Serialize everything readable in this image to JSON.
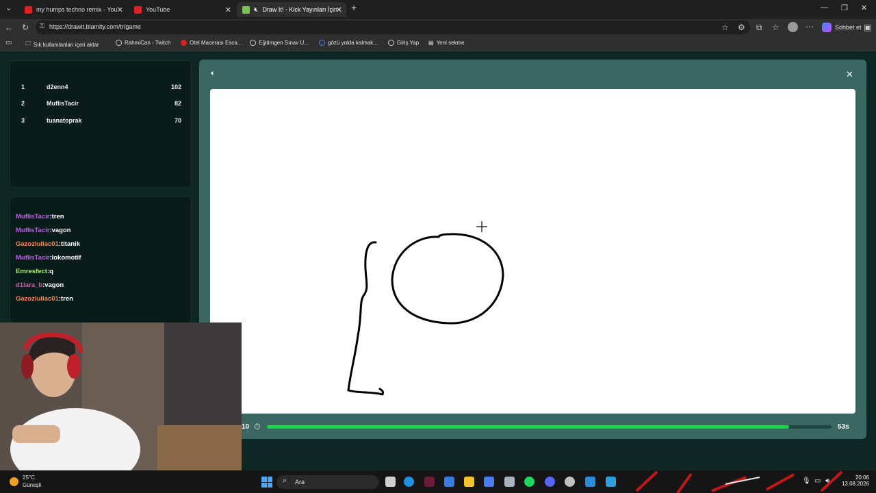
{
  "browser": {
    "tabs": [
      {
        "label": "my humps techno remix - YouTub",
        "active": false
      },
      {
        "label": "YouTube",
        "active": false
      },
      {
        "label": "Draw It! - Kick Yayınları İçin Ç",
        "active": true
      }
    ],
    "url": "https://drawit.blamity.com/tr/game",
    "profile_label": "Sohbet et",
    "bookmarks": [
      "Sık kullanılanları içeri aktar",
      "RahmiCan - Twitch",
      "Otel Macerası Esca...",
      "Eğitimgen Sınav U...",
      "gözü yolda kalmak...",
      "Giriş Yap",
      "Yeni sekme"
    ]
  },
  "leaderboard": [
    {
      "rank": "1",
      "name": "d2enn4",
      "score": "102"
    },
    {
      "rank": "2",
      "name": "MuflisTacir",
      "score": "82"
    },
    {
      "rank": "3",
      "name": "tuanatoprak",
      "score": "70"
    }
  ],
  "chat": [
    {
      "user": "MuflisTacir",
      "msg": ":tren",
      "color": "#c55cf0"
    },
    {
      "user": "MuflisTacir",
      "msg": ":vagon",
      "color": "#c55cf0"
    },
    {
      "user": "Gazozlullac01",
      "msg": ":titanik",
      "color": "#f08a4b"
    },
    {
      "user": "MuflisTacir",
      "msg": ":lokomotif",
      "color": "#c55cf0"
    },
    {
      "user": "Emresfect",
      "msg": ":q",
      "color": "#a7f07a"
    },
    {
      "user": "d1lara_b",
      "msg": ":vagon",
      "color": "#e055b0"
    },
    {
      "user": "Gazozlullac01",
      "msg": ":tren",
      "color": "#f08a4b"
    }
  ],
  "game": {
    "round": "10",
    "time_left": "53s",
    "progress": 0.925
  },
  "taskbar": {
    "temp": "25°C",
    "weather": "Güneşli",
    "search": "Ara",
    "time": "20:06",
    "date": "13.08.2026"
  },
  "colors": {
    "accent": "#22d14a",
    "panel": "#3a6762",
    "bg": "#0e2724"
  }
}
